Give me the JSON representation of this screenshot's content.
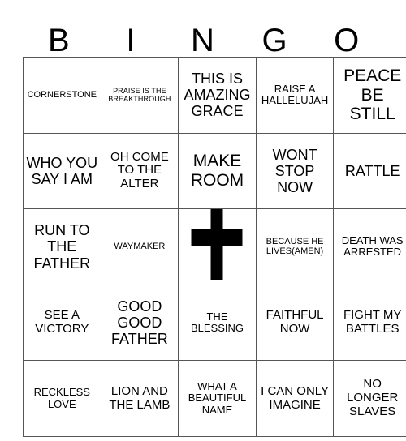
{
  "card": {
    "title": "BINGO",
    "columns": [
      "B",
      "I",
      "N",
      "G",
      "O"
    ],
    "free_space": {
      "position": "center",
      "icon": "cross-icon",
      "color": "#000000"
    },
    "border_color": "#555555",
    "background_color": "#ffffff",
    "text_color": "#000000",
    "rows": [
      [
        {
          "text": "CORNERSTONE",
          "size": "sm"
        },
        {
          "text": "PRAISE IS THE BREAKTHROUGH",
          "size": "xs"
        },
        {
          "text": "THIS IS AMAZING GRACE",
          "size": "xl"
        },
        {
          "text": "RAISE A HALLELUJAH",
          "size": "md"
        },
        {
          "text": "PEACE BE STILL",
          "size": "xxl"
        }
      ],
      [
        {
          "text": "WHO YOU SAY I AM",
          "size": "xl"
        },
        {
          "text": "OH COME TO THE ALTER",
          "size": "lg"
        },
        {
          "text": "MAKE ROOM",
          "size": "xxl"
        },
        {
          "text": "WONT STOP NOW",
          "size": "xl"
        },
        {
          "text": "RATTLE",
          "size": "xl"
        }
      ],
      [
        {
          "text": "RUN TO THE FATHER",
          "size": "xl"
        },
        {
          "text": "WAYMAKER",
          "size": "sm"
        },
        {
          "text": "",
          "size": "md",
          "free": true
        },
        {
          "text": "BECAUSE HE LIVES(AMEN)",
          "size": "sm"
        },
        {
          "text": "DEATH WAS ARRESTED",
          "size": "md"
        }
      ],
      [
        {
          "text": "SEE A VICTORY",
          "size": "lg"
        },
        {
          "text": "GOOD GOOD FATHER",
          "size": "xl"
        },
        {
          "text": "THE BLESSING",
          "size": "md"
        },
        {
          "text": "FAITHFUL NOW",
          "size": "lg"
        },
        {
          "text": "FIGHT MY BATTLES",
          "size": "lg"
        }
      ],
      [
        {
          "text": "RECKLESS LOVE",
          "size": "md"
        },
        {
          "text": "LION AND THE LAMB",
          "size": "lg"
        },
        {
          "text": "WHAT A BEAUTIFUL NAME",
          "size": "md"
        },
        {
          "text": "I CAN ONLY IMAGINE",
          "size": "lg"
        },
        {
          "text": "NO LONGER SLAVES",
          "size": "lg"
        }
      ]
    ]
  }
}
